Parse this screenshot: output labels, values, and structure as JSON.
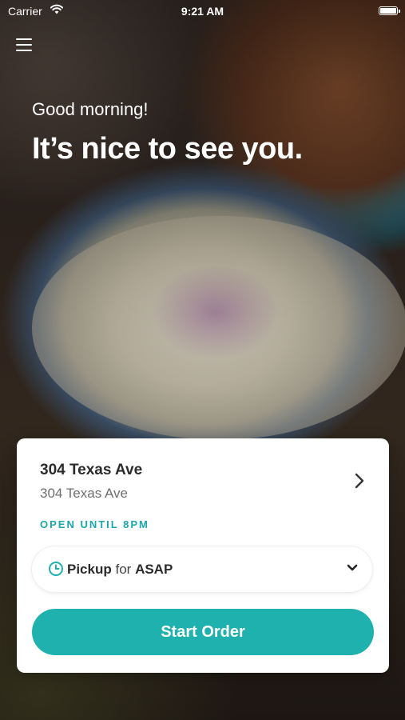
{
  "status_bar": {
    "carrier": "Carrier",
    "time": "9:21 AM"
  },
  "icons": {
    "menu": "hamburger-menu-icon",
    "wifi": "wifi-icon",
    "battery": "battery-icon",
    "location_chevron": "chevron-right-icon",
    "clock": "clock-icon",
    "dropdown": "chevron-down-icon"
  },
  "hero": {
    "greeting": "Good morning!",
    "headline": "It’s nice to see you."
  },
  "location_card": {
    "name": "304 Texas Ave",
    "address": "304 Texas Ave",
    "hours": "OPEN UNTIL 8PM",
    "order_mode": {
      "mode": "Pickup",
      "connector": "for",
      "timing": "ASAP"
    },
    "cta_label": "Start Order"
  },
  "colors": {
    "accent": "#1fb1ae",
    "hours_text": "#1aa8aa",
    "card_bg": "#ffffff"
  }
}
